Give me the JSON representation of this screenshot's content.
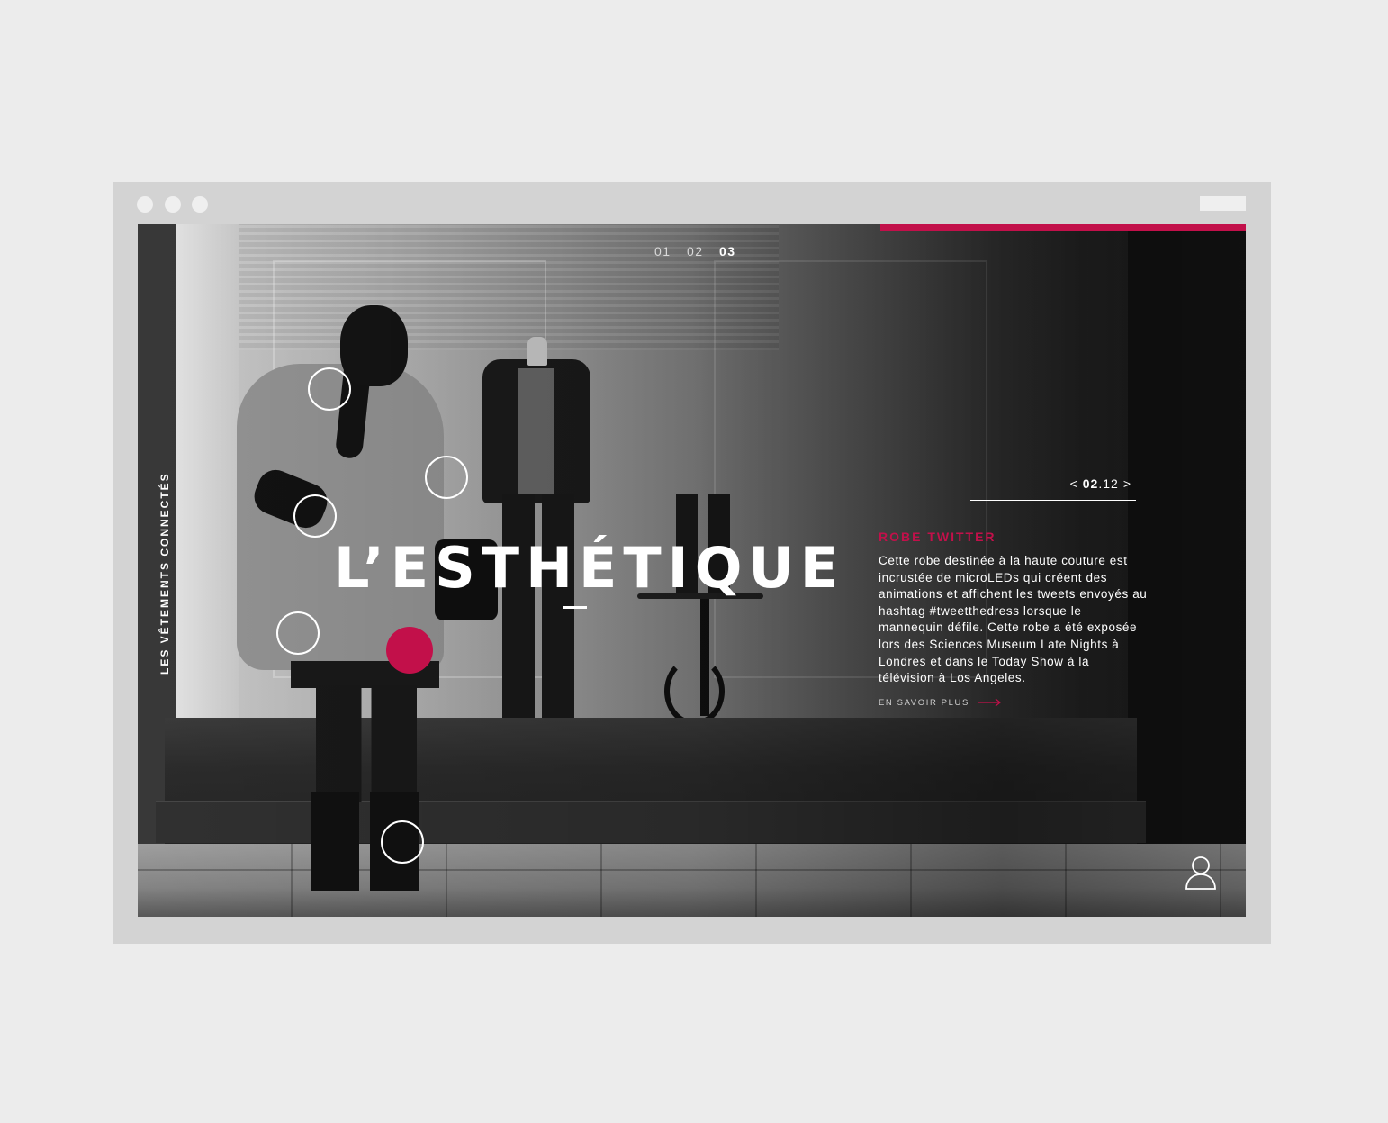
{
  "pager": {
    "items": [
      "01",
      "02",
      "03"
    ],
    "active_index": 2
  },
  "side_label": "LES VÊTEMENTS CONNECTÉS",
  "hero": {
    "title": "L’ESTHÉTIQUE"
  },
  "counter": {
    "prev": "<",
    "current": "02",
    "separator": ".",
    "total": "12",
    "next": ">"
  },
  "info": {
    "title": "ROBE TWITTER",
    "body": "Cette robe destinée à la haute couture est incrustée de microLEDs qui créent des animations et affichent les tweets envoyés au hashtag #tweetthedress lorsque le mannequin défile. Cette robe a été exposée lors des Sciences Museum Late Nights à Londres et dans le Today Show à la télévision à Los Angeles.",
    "link_label": "EN SAVOIR PLUS"
  },
  "colors": {
    "accent": "#c2104a",
    "browser_chrome": "#d3d3d3",
    "background": "#ececec"
  },
  "icons": {
    "user": "user-icon",
    "arrow": "arrow-right-icon"
  }
}
